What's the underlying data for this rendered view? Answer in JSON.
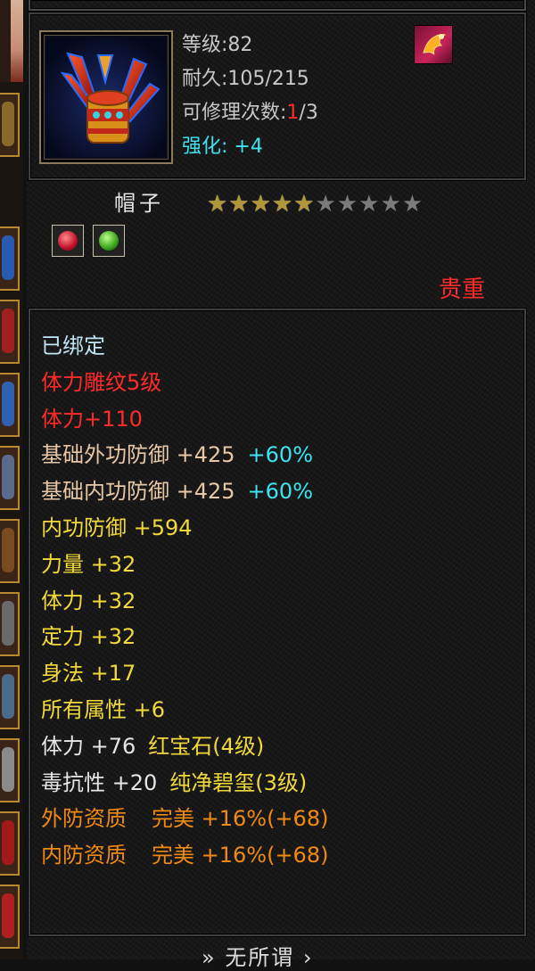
{
  "item": {
    "level": "等级:82",
    "durability": "耐久:105/215",
    "repair_prefix": "可修理次数:",
    "repair_count": "1",
    "repair_max": "/3",
    "enhance_label": "强化:",
    "enhance_value": "+4",
    "name": "帽子",
    "stars_filled": "★★★★★",
    "stars_empty": "★★★★★",
    "star_level": 5,
    "star_max": 10,
    "rarity": "贵重",
    "icon": "hat-icon",
    "top_right_icon": "phoenix-emblem-icon",
    "gems": [
      "red-gem-icon",
      "green-gem-icon"
    ]
  },
  "attributes": [
    {
      "text": "已绑定",
      "color": "lightblue"
    },
    {
      "text": "体力雕纹5级",
      "color": "red"
    },
    {
      "text": "体力+110",
      "color": "red"
    },
    {
      "text": "基础外功防御 +425",
      "extra": "+60%",
      "color": "tan",
      "extra_color": "cyan"
    },
    {
      "text": "基础内功防御 +425",
      "extra": "+60%",
      "color": "tan",
      "extra_color": "cyan"
    },
    {
      "text": "内功防御 +594",
      "color": "yellow"
    },
    {
      "text": "力量 +32",
      "color": "yellow"
    },
    {
      "text": "体力 +32",
      "color": "yellow"
    },
    {
      "text": "定力 +32",
      "color": "yellow"
    },
    {
      "text": "身法 +17",
      "color": "yellow"
    },
    {
      "text": "所有属性 +6",
      "color": "yellow"
    },
    {
      "text": "体力 +76",
      "extra": "红宝石(4级)",
      "color": "white",
      "extra_color": "yellow"
    },
    {
      "text": "毒抗性 +20",
      "extra": "纯净碧玺(3级)",
      "color": "white",
      "extra_color": "yellow"
    },
    {
      "text": "外防资质",
      "extra": "完美 +16%(+68)",
      "color": "orange",
      "extra_color": "orange"
    },
    {
      "text": "内防资质",
      "extra": "完美 +16%(+68)",
      "color": "orange",
      "extra_color": "orange"
    }
  ],
  "footer": "»  无所谓 ›",
  "colors": {
    "red": "#ff2a2a",
    "cyan": "#3fe3f0",
    "yellow": "#f2d93a",
    "orange": "#f08a12",
    "tan": "#e7c7a6",
    "lightblue": "#bfe4f4",
    "star_gold": "#b0973a",
    "star_grey": "#7b7b7b"
  }
}
